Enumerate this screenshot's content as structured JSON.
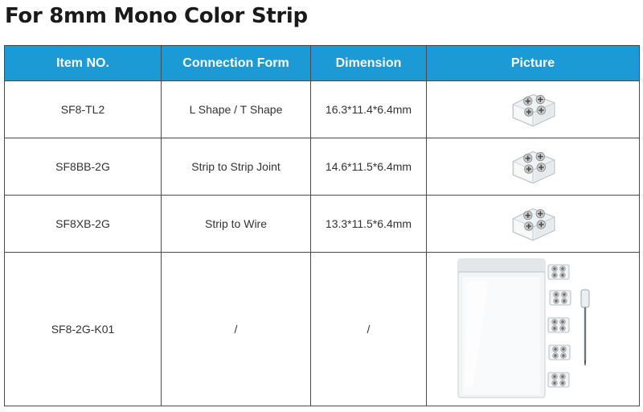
{
  "page": {
    "title": "For 8mm Mono Color Strip"
  },
  "table": {
    "headers": [
      "Item NO.",
      "Connection Form",
      "Dimension",
      "Picture"
    ],
    "rows": [
      {
        "item": "SF8-TL2",
        "form": "L Shape / T Shape",
        "dimension": "16.3*11.4*6.4mm",
        "picture_icon": "connector-photo"
      },
      {
        "item": "SF8BB-2G",
        "form": "Strip to Strip Joint",
        "dimension": "14.6*11.5*6.4mm",
        "picture_icon": "connector-photo"
      },
      {
        "item": "SF8XB-2G",
        "form": "Strip to Wire",
        "dimension": "13.3*11.5*6.4mm",
        "picture_icon": "connector-photo"
      },
      {
        "item": "SF8-2G-K01",
        "form": "/",
        "dimension": "/",
        "picture_icon": "kit-bag-photo"
      }
    ]
  },
  "colors": {
    "header_bg": "#1b9ad6",
    "header_text": "#ffffff",
    "border": "#4a4a4a"
  }
}
